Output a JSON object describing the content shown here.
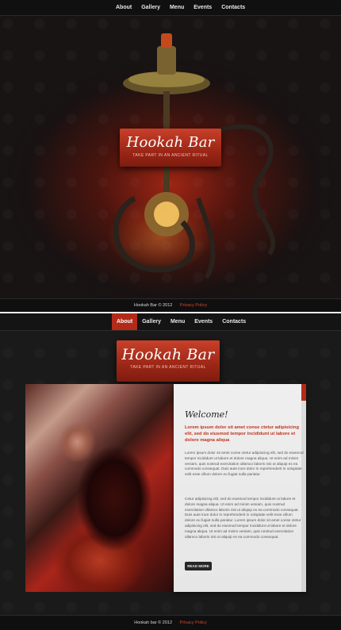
{
  "nav": {
    "items": [
      "About",
      "Gallery",
      "Menu",
      "Events",
      "Contacts"
    ]
  },
  "brand": {
    "title": "Hookah Bar",
    "tagline": "Take part in an ancient ritual"
  },
  "footer1": {
    "copyright": "Hookah Bar © 2012",
    "privacy": "Privacy Policy"
  },
  "footer2": {
    "copyright": "Hookah bar © 2012",
    "privacy": "Privacy Policy"
  },
  "about": {
    "heading": "Welcome!",
    "lead": "Lorem ipsum dolor sit amet conse ctetur adipisicing elit, sed do eiusmod tempor incididunt ut labore et dolore magna aliqua",
    "paragraphs": [
      "Lorem ipsum dolor sit amet conse ctetur adipisicing elit, sed do eiusmod tempor incididunt ut labore et dolore magna aliqua. Ut enim ad minim veniam, quis nostrud exercitation ullamco laboris nisi ut aliquip ex ea commodo consequat. Duis aute irure dolor in reprehenderit in voluptate velit esse cillum dolore eu fugiat nulla pariatur.",
      "Cetur adipisicing elit, sed do eiusmod tempor incididunt ut labore et dolore magna aliqua. Ut enim ad minim veniam, quis nostrud exercitation ullamco laboris nisi ut aliquip ex ea commodo consequat. Duis aute irure dolor in reprehenderit in voluptate velit esse cillum dolore eu fugiat nulla pariatur. Lorem ipsum dolor sit amet conse ctetur adipisicing elit, sed do eiusmod tempor incididunt ut labore et dolore magna aliqua. Ut enim ad minim veniam, quis nostrud exercitation ullamco laboris nisi ut aliquip ex ea commodo consequat."
    ],
    "more_button": "READ MORE"
  },
  "colors": {
    "accent": "#b22a18",
    "background": "#151515"
  }
}
